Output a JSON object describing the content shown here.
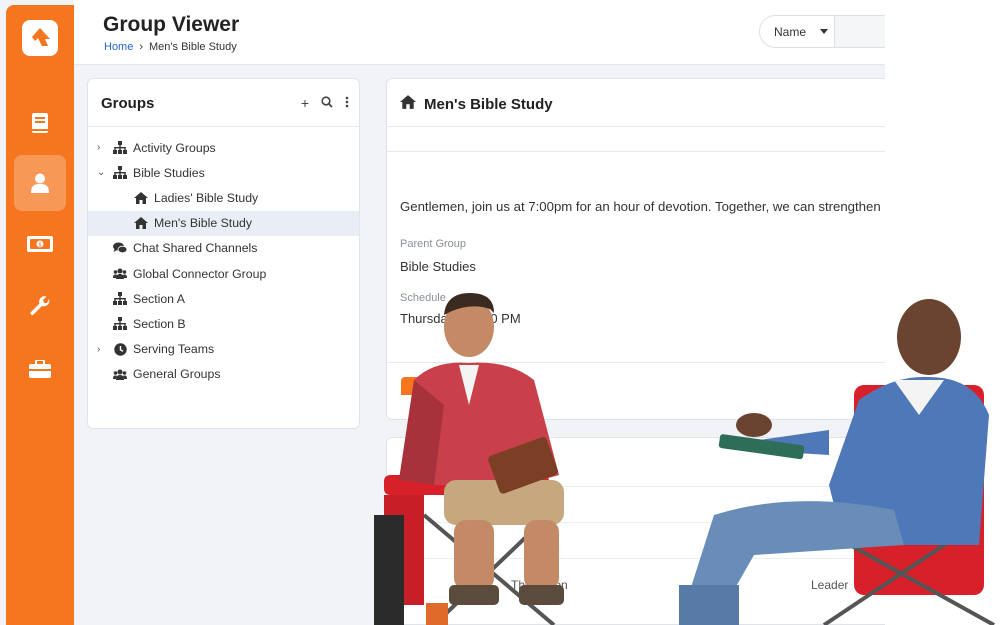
{
  "header": {
    "title": "Group Viewer",
    "breadcrumb": [
      "Home",
      "Men's Bible Study"
    ],
    "sort_label": "Name"
  },
  "sidebar": {
    "items": [
      {
        "icon": "book-icon",
        "active": false
      },
      {
        "icon": "person-icon",
        "active": true
      },
      {
        "icon": "money-icon",
        "active": false
      },
      {
        "icon": "wrench-icon",
        "active": false
      },
      {
        "icon": "briefcase-icon",
        "active": false
      }
    ]
  },
  "groups_panel": {
    "title": "Groups",
    "actions": [
      "+",
      "search-icon",
      "more-icon"
    ],
    "tree": [
      {
        "label": "Activity Groups",
        "icon": "sitemap-icon",
        "chevron": "›",
        "level": 0
      },
      {
        "label": "Bible Studies",
        "icon": "sitemap-icon",
        "chevron": "⌄",
        "level": 0
      },
      {
        "label": "Ladies' Bible Study",
        "icon": "home-icon",
        "chevron": "",
        "level": 1
      },
      {
        "label": "Men's Bible Study",
        "icon": "home-icon",
        "chevron": "",
        "level": 1,
        "selected": true
      },
      {
        "label": "Chat Shared Channels",
        "icon": "chat-icon",
        "chevron": "",
        "level": 0
      },
      {
        "label": "Global Connector Group",
        "icon": "users-icon",
        "chevron": "",
        "level": 0
      },
      {
        "label": "Section A",
        "icon": "sitemap-icon",
        "chevron": "",
        "level": 0
      },
      {
        "label": "Section B",
        "icon": "sitemap-icon",
        "chevron": "",
        "level": 0
      },
      {
        "label": "Serving Teams",
        "icon": "clock-icon",
        "chevron": "›",
        "level": 0
      },
      {
        "label": "General Groups",
        "icon": "users-icon",
        "chevron": "",
        "level": 0
      }
    ]
  },
  "detail": {
    "title": "Men's Bible Study",
    "description": "Gentlemen, join us at 7:00pm for an hour of devotion. Together, we can strengthen",
    "parent_group_label": "Parent Group",
    "parent_group_value": "Bible Studies",
    "schedule_label": "Schedule",
    "schedule_value": "Thursday at 7:00 PM"
  },
  "lower": {
    "cell_a": "Thompson",
    "cell_b": "Leader"
  },
  "colors": {
    "accent": "#f5761f",
    "link": "#1f67c9",
    "selected_row": "#e9eef6"
  }
}
